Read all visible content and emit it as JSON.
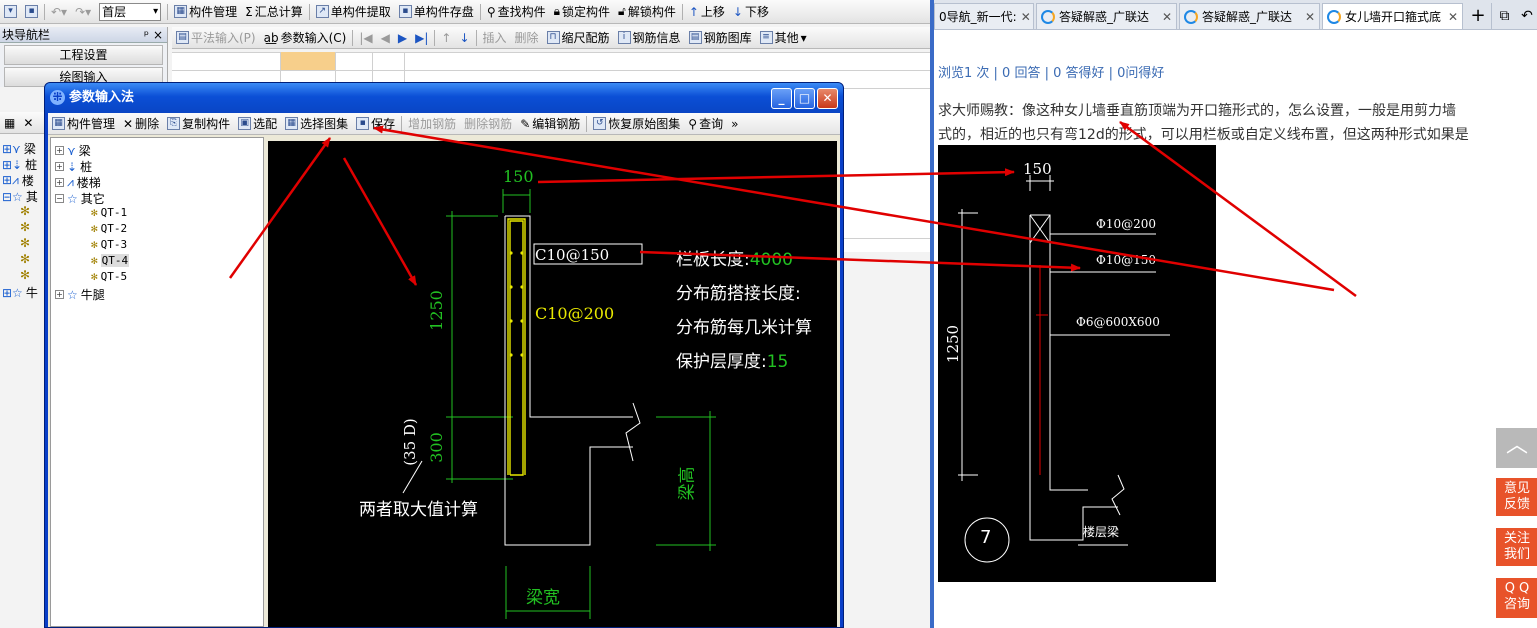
{
  "main_toolbar": {
    "floor_select": "首层",
    "items": [
      "构件管理",
      "汇总计算",
      "单构件提取",
      "单构件存盘",
      "查找构件",
      "锁定构件",
      "解锁构件",
      "上移",
      "下移"
    ]
  },
  "second_toolbar": {
    "items": [
      "平法输入(P)",
      "参数输入(C)",
      "插入",
      "删除",
      "缩尺配筋",
      "钢筋信息",
      "钢筋图库",
      "其他"
    ]
  },
  "nav_panel": {
    "title": "块导航栏",
    "pin": "ᵖ",
    "close": "×",
    "buttons": [
      "工程设置",
      "绘图输入"
    ]
  },
  "bg_tree": [
    "梁",
    "桩",
    "楼",
    "其",
    "牛"
  ],
  "dialog": {
    "title": "参数输入法",
    "toolbar": [
      "构件管理",
      "删除",
      "复制构件",
      "选配",
      "选择图集",
      "保存",
      "增加钢筋",
      "删除钢筋",
      "编辑钢筋",
      "恢复原始图集",
      "查询"
    ],
    "more": "»",
    "tree": {
      "items": [
        "梁",
        "桩",
        "楼梯",
        "其它"
      ],
      "children": [
        "QT-1",
        "QT-2",
        "QT-3",
        "QT-4",
        "QT-5"
      ],
      "last": "牛腿"
    },
    "drawing": {
      "dim_width": "150",
      "dim_height": "1250",
      "dim_bottom": "300",
      "anchor_note": "(35 D)",
      "bar_vertical": "C10@150",
      "bar_dist": "C10@200",
      "props": [
        {
          "label": "栏板长度:",
          "value": "4000"
        },
        {
          "label": "分布筋搭接长度:",
          "value": ""
        },
        {
          "label": "分布筋每几米计算",
          "value": ""
        },
        {
          "label": "保护层厚度:",
          "value": "15"
        }
      ],
      "note_max": "两者取大值计算",
      "beam_height": "梁高",
      "beam_width": "梁宽"
    }
  },
  "browser": {
    "tabs": [
      {
        "label": "0导航_新一代:",
        "active": false
      },
      {
        "label": "答疑解惑_广联达",
        "active": false
      },
      {
        "label": "答疑解惑_广联达",
        "active": false
      },
      {
        "label": "女儿墙开口箍式底",
        "active": true
      }
    ],
    "new_tab": "+",
    "stats": "浏览1 次 | 0 回答 | 0 答得好 | 0问得好",
    "question_line1": "求大师赐教：像这种女儿墙垂直筋顶端为开口箍形式的，怎么设置，一般是用剪力墙",
    "question_line2": "式的，相近的也只有弯12d的形式，可以用栏板或自定义线布置，但这两种形式如果是",
    "image": {
      "dim_width": "150",
      "dim_height": "1250",
      "bar1": "Φ10@200",
      "bar2": "Φ10@150",
      "bar3": "Φ6@600X600",
      "floor_beam": "楼层梁",
      "circle_label": "7"
    },
    "side_buttons": [
      {
        "line1": "意见",
        "line2": "反馈"
      },
      {
        "line1": "关注",
        "line2": "我们"
      },
      {
        "line1": "Q Q",
        "line2": "咨询"
      }
    ],
    "top_button": "︿"
  },
  "colors": {
    "dialog_title": "#0b4fd6",
    "canvas_bg": "#000000",
    "cad_green": "#22c122",
    "cad_yellow": "#e8e800",
    "link_blue": "#3b6bb3",
    "annotation_red": "#e00000",
    "side_button": "#e8532a"
  }
}
